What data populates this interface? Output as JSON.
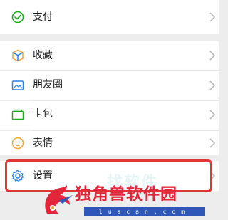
{
  "menu": {
    "items": [
      {
        "label": "支付",
        "icon": "pay-icon"
      },
      {
        "label": "收藏",
        "icon": "favorites-icon"
      },
      {
        "label": "朋友圈",
        "icon": "moments-icon"
      },
      {
        "label": "卡包",
        "icon": "card-pack-icon"
      },
      {
        "label": "表情",
        "icon": "sticker-icon"
      },
      {
        "label": "设置",
        "icon": "settings-icon"
      }
    ]
  },
  "watermark": {
    "name": "独角兽软件园",
    "domain": "luacan.com",
    "ghost": "找软件"
  },
  "colors": {
    "highlight": "#e03636",
    "pay": "#1aad19",
    "icon_blue": "#2a82e4",
    "watermark_red": "#e3263a",
    "watermark_blue": "#2f57b8"
  }
}
